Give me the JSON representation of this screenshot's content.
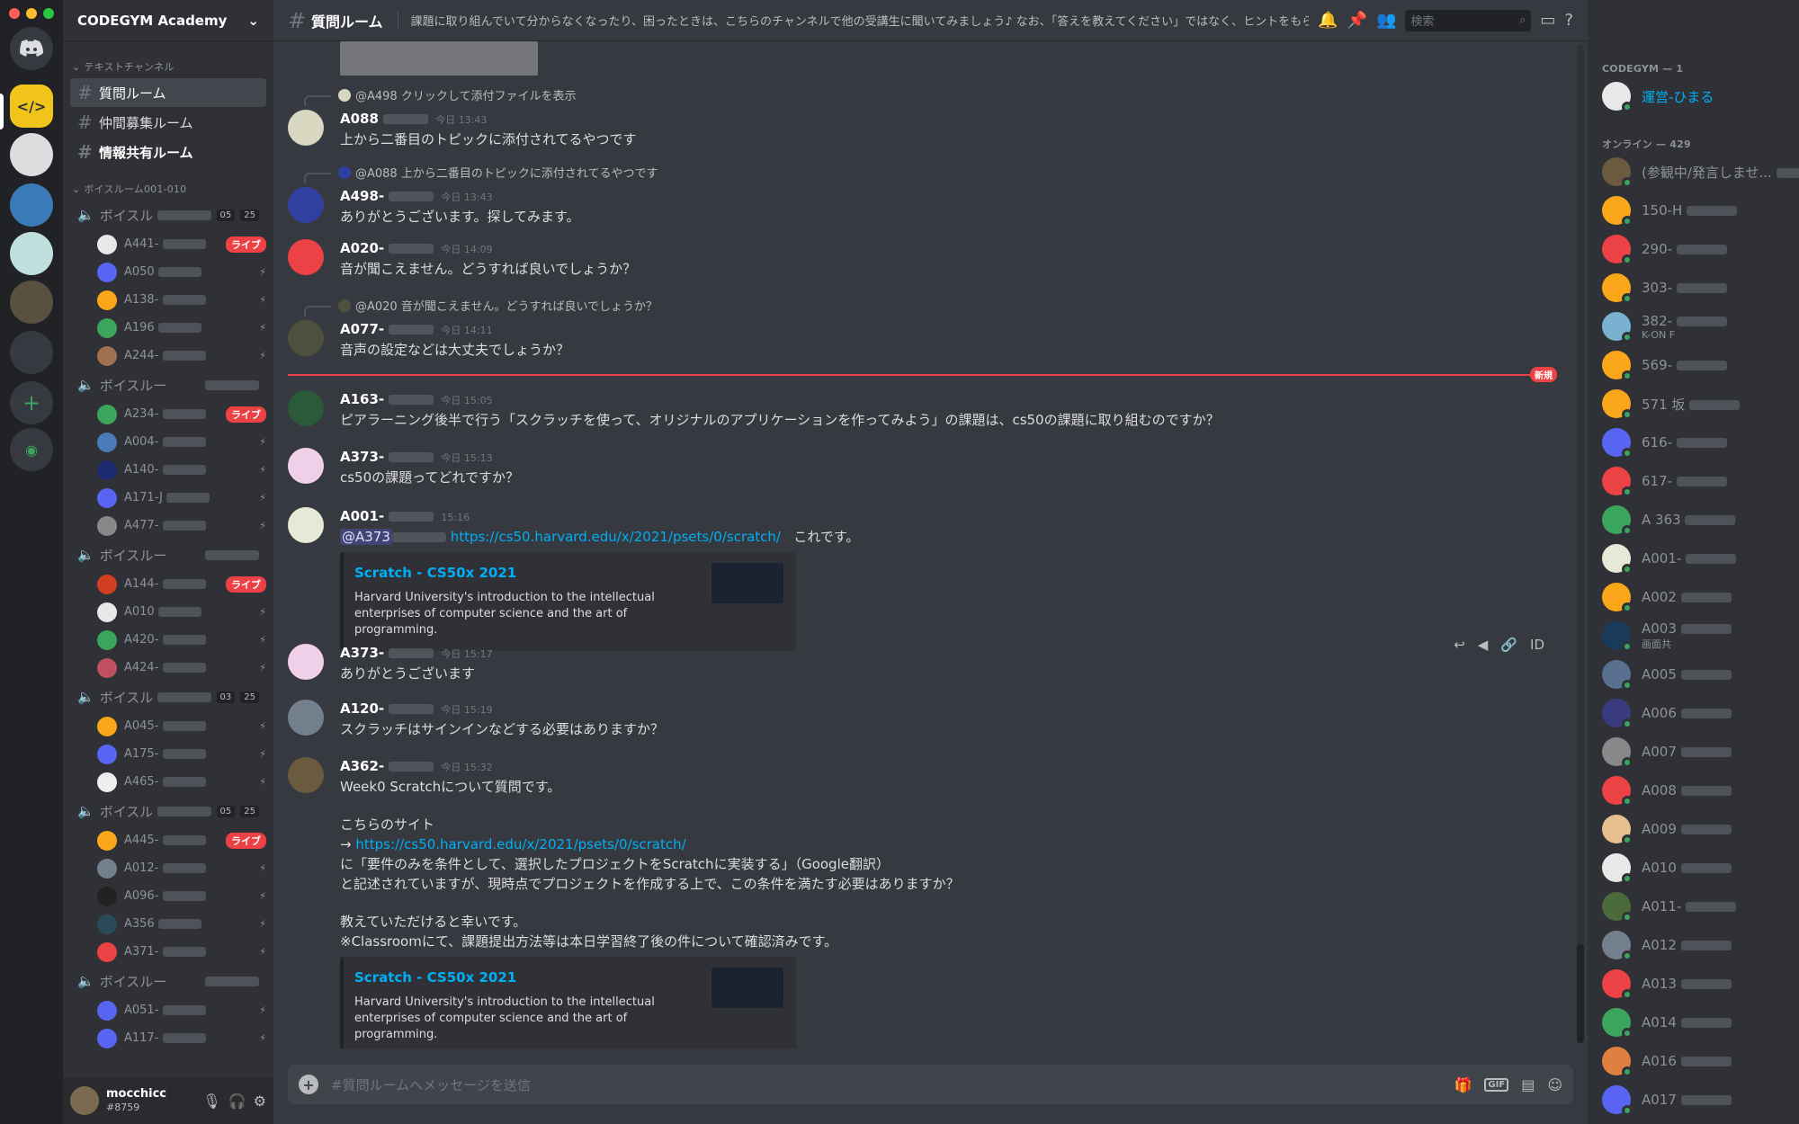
{
  "app": {
    "server_name": "CODEGYM Academy"
  },
  "sidebar": {
    "text_category": "テキストチャンネル",
    "channels": [
      {
        "label": "質問ルーム",
        "active": true
      },
      {
        "label": "仲間募集ルーム",
        "active": false
      },
      {
        "label": "情報共有ルーム",
        "active": false
      }
    ],
    "voice_category": "ボイスルーム001-010",
    "voice_rooms": [
      {
        "label": "ボイスルーム...",
        "badge1": "05",
        "badge2": "25",
        "users": [
          {
            "name": "A441-",
            "live": "ライブ",
            "color": "#e8e8e8"
          },
          {
            "name": "A050",
            "live": "",
            "color": "#5865f2"
          },
          {
            "name": "A138-",
            "live": "",
            "color": "#faa61a"
          },
          {
            "name": "A196",
            "live": "",
            "color": "#3ba55d"
          },
          {
            "name": "A244-",
            "live": "",
            "color": "#a07050"
          }
        ]
      },
      {
        "label": "ボイスルー",
        "badge1": "",
        "badge2": "",
        "users": [
          {
            "name": "A234-",
            "live": "ライブ",
            "color": "#3ba55d"
          },
          {
            "name": "A004-",
            "live": "",
            "color": "#4a7ab8"
          },
          {
            "name": "A140-",
            "live": "",
            "color": "#1c2a70"
          },
          {
            "name": "A171-J",
            "live": "",
            "color": "#5865f2"
          },
          {
            "name": "A477-",
            "live": "",
            "color": "#888"
          }
        ]
      },
      {
        "label": "ボイスルー",
        "badge1": "",
        "badge2": "",
        "users": [
          {
            "name": "A144-",
            "live": "ライブ",
            "color": "#d04020"
          },
          {
            "name": "A010",
            "live": "",
            "color": "#e8e8e8"
          },
          {
            "name": "A420-",
            "live": "",
            "color": "#3ba55d"
          },
          {
            "name": "A424-",
            "live": "",
            "color": "#c05060"
          }
        ]
      },
      {
        "label": "ボイスルー",
        "badge1": "03",
        "badge2": "25",
        "users": [
          {
            "name": "A045-",
            "live": "",
            "color": "#faa61a"
          },
          {
            "name": "A175-",
            "live": "",
            "color": "#5865f2"
          },
          {
            "name": "A465-",
            "live": "",
            "color": "#eee"
          }
        ]
      },
      {
        "label": "ボイスルー",
        "badge1": "05",
        "badge2": "25",
        "users": [
          {
            "name": "A445-",
            "live": "ライブ",
            "color": "#faa61a"
          },
          {
            "name": "A012-",
            "live": "",
            "color": "#747f8d"
          },
          {
            "name": "A096-",
            "live": "",
            "color": "#222"
          },
          {
            "name": "A356",
            "live": "",
            "color": "#2a4a5a"
          },
          {
            "name": "A371-",
            "live": "",
            "color": "#ed4245"
          }
        ]
      },
      {
        "label": "ボイスルー",
        "badge1": "",
        "badge2": "",
        "users": [
          {
            "name": "A051-",
            "live": "",
            "color": "#5865f2"
          },
          {
            "name": "A117-",
            "live": "",
            "color": "#5865f2"
          }
        ]
      }
    ],
    "user": {
      "name": "mocchicc",
      "tag": "#8759"
    }
  },
  "topbar": {
    "channel": "質問ルーム",
    "topic": "課題に取り組んでいて分からなくなったり、困ったときは、こちらのチャンネルで他の受講生に聞いてみましょう♪ なお、「答えを教えてください」ではなく、ヒントをもらうことを心がけ...",
    "search_placeholder": "検索"
  },
  "messages": [
    {
      "reply": "@A498 クリックして添付ファイルを表示",
      "author": "A088",
      "time": "今日 13:43",
      "text": "上から二番目のトピックに添付されてるやつです",
      "color": "#d8d8c0"
    },
    {
      "reply": "@A088 上から二番目のトピックに添付されてるやつです",
      "author": "A498-",
      "time": "今日 13:43",
      "text": "ありがとうございます。探してみます。",
      "color": "#3040a0"
    },
    {
      "reply": "",
      "author": "A020-",
      "time": "今日 14:09",
      "text": "音が聞こえません。どうすれば良いでしょうか？",
      "color": "#ed4245"
    },
    {
      "reply": "@A020 音が聞こえません。どうすれば良いでしょうか？",
      "author": "A077-",
      "time": "今日 14:11",
      "text": "音声の設定などは大丈夫でしょうか？",
      "color": "#505040"
    },
    {
      "reply": "",
      "author": "A163-",
      "time": "今日 15:05",
      "text": "ピアラーニング後半で行う「スクラッチを使って、オリジナルのアプリケーションを作ってみよう」の課題は、cs50の課題に取り組むのですか？",
      "color": "#2a5a3a"
    },
    {
      "reply": "",
      "author": "A373-",
      "time": "今日 15:13",
      "text": "cs50の課題ってどれですか？",
      "color": "#f0d0e8"
    },
    {
      "reply": "",
      "author": "A001-",
      "time": "15:16",
      "text": "これです。",
      "mention": "@A373",
      "link": "https://cs50.harvard.edu/x/2021/psets/0/scratch/",
      "color": "#e8e8d8"
    },
    {
      "reply": "",
      "author": "A373-",
      "time": "今日 15:17",
      "text": "ありがとうございます",
      "color": "#f0d0e8"
    },
    {
      "reply": "",
      "author": "A120-",
      "time": "今日 15:19",
      "text": "スクラッチはサインインなどする必要はありますか？",
      "color": "#747f8d"
    },
    {
      "reply": "",
      "author": "A362-",
      "time": "今日 15:32",
      "text": "Week0 Scratchについて質問です。",
      "color": "#6a5a40"
    }
  ],
  "long_message": {
    "line1": "こちらのサイト",
    "arrow": "→",
    "link": "https://cs50.harvard.edu/x/2021/psets/0/scratch/",
    "line2": "に「要件のみを条件として、選択したプロジェクトをScratchに実装する」（Google翻訳）",
    "line3": "と記述されていますが、現時点でプロジェクトを作成する上で、この条件を満たす必要はありますか？",
    "line4": "教えていただけると幸いです。",
    "line5": "※Classroomにて、課題提出方法等は本日学習終了後の件について確認済みです。"
  },
  "embed": {
    "title": "Scratch - CS50x 2021",
    "desc": "Harvard University's introduction to the intellectual enterprises of computer science and the art of programming."
  },
  "new_label": "新規",
  "composer": {
    "placeholder": "#質問ルームへメッセージを送信",
    "gif": "GIF"
  },
  "members": {
    "cat1": "CODEGYM — 1",
    "admin": "運営-ひまる",
    "cat2": "オンライン — 429",
    "list": [
      {
        "name": "(参観中/発言しませ...",
        "sub": "",
        "color": "#6a5a40"
      },
      {
        "name": "150-H",
        "sub": "",
        "color": "#faa61a"
      },
      {
        "name": "290-",
        "sub": "",
        "color": "#ed4245"
      },
      {
        "name": "303-",
        "sub": "",
        "color": "#faa61a"
      },
      {
        "name": "382-",
        "sub": "K-ON F",
        "color": "#7ab0d0"
      },
      {
        "name": "569-",
        "sub": "",
        "color": "#faa61a"
      },
      {
        "name": "571 坂",
        "sub": "",
        "color": "#faa61a"
      },
      {
        "name": "616-",
        "sub": "",
        "color": "#5865f2"
      },
      {
        "name": "617-",
        "sub": "",
        "color": "#ed4245"
      },
      {
        "name": "A 363",
        "sub": "",
        "color": "#3ba55d"
      },
      {
        "name": "A001-",
        "sub": "",
        "color": "#e8e8d8"
      },
      {
        "name": "A002",
        "sub": "",
        "color": "#faa61a"
      },
      {
        "name": "A003",
        "sub": "画面共",
        "color": "#1a3a5a"
      },
      {
        "name": "A005",
        "sub": "",
        "color": "#5a7090"
      },
      {
        "name": "A006",
        "sub": "",
        "color": "#3a3a80"
      },
      {
        "name": "A007",
        "sub": "",
        "color": "#888"
      },
      {
        "name": "A008",
        "sub": "",
        "color": "#ed4245"
      },
      {
        "name": "A009",
        "sub": "",
        "color": "#e8c090"
      },
      {
        "name": "A010",
        "sub": "",
        "color": "#e8e8e8"
      },
      {
        "name": "A011-",
        "sub": "",
        "color": "#4a6a3a"
      },
      {
        "name": "A012",
        "sub": "",
        "color": "#747f8d"
      },
      {
        "name": "A013",
        "sub": "",
        "color": "#ed4245"
      },
      {
        "name": "A014",
        "sub": "",
        "color": "#3ba55d"
      },
      {
        "name": "A016",
        "sub": "",
        "color": "#e08040"
      },
      {
        "name": "A017",
        "sub": "",
        "color": "#5865f2"
      }
    ]
  },
  "colors": {
    "accent": "#5865f2",
    "online": "#3ba55d",
    "live": "#ed4245",
    "link": "#00aff4"
  }
}
